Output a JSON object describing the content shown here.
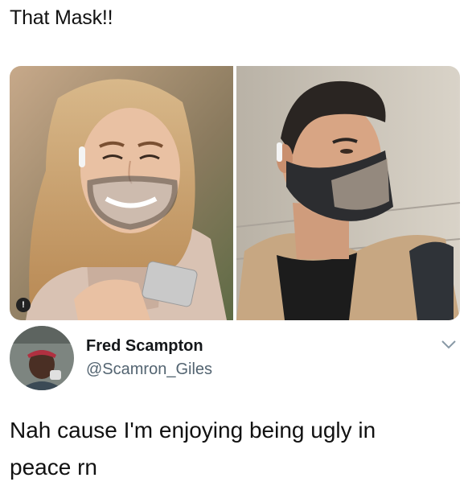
{
  "caption": "That Mask!!",
  "alt_badge": "!",
  "tweet": {
    "name": "Fred Scampton",
    "handle": "@Scamron_Giles",
    "text_line1": "Nah cause I'm enjoying being ugly in",
    "text_line2": "peace rn"
  },
  "icons": [
    "chevron-down-icon",
    "avatar-photo",
    "alert-icon"
  ],
  "colors": {
    "text": "#14171a",
    "handle": "#536471",
    "mask": "#3a3a3a"
  }
}
